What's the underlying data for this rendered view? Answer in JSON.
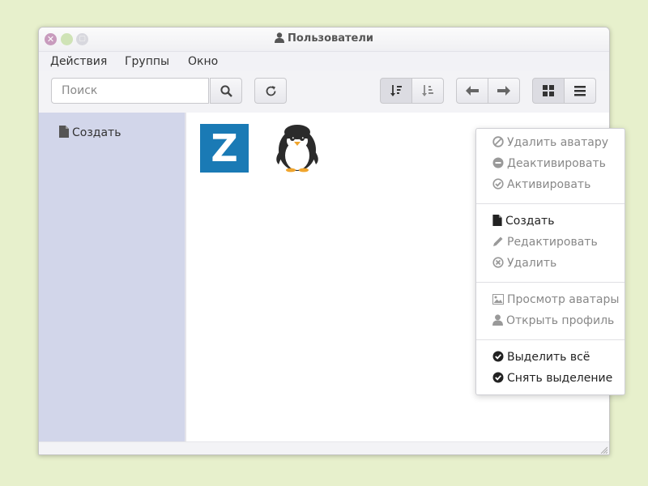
{
  "window": {
    "title": "Пользователи"
  },
  "menubar": {
    "items": [
      "Действия",
      "Группы",
      "Окно"
    ]
  },
  "toolbar": {
    "search_placeholder": "Поиск"
  },
  "sidebar": {
    "items": [
      {
        "label": "Создать"
      }
    ]
  },
  "avatars": [
    {
      "letter": "Z",
      "bg": "#1a7ab5"
    },
    {
      "letter": "",
      "bg": "#ffffff"
    }
  ],
  "context_menu": {
    "groups": [
      [
        {
          "label": "Удалить аватару",
          "icon": "ban-icon",
          "enabled": false
        },
        {
          "label": "Деактивировать",
          "icon": "minus-circle-icon",
          "enabled": false
        },
        {
          "label": "Активировать",
          "icon": "check-circle-outline-icon",
          "enabled": false
        }
      ],
      [
        {
          "label": "Создать",
          "icon": "file-icon",
          "enabled": true
        },
        {
          "label": "Редактировать",
          "icon": "pencil-icon",
          "enabled": false
        },
        {
          "label": "Удалить",
          "icon": "x-circle-icon",
          "enabled": false
        }
      ],
      [
        {
          "label": "Просмотр аватары",
          "icon": "picture-icon",
          "enabled": false
        },
        {
          "label": "Открыть профиль",
          "icon": "user-icon",
          "enabled": false
        }
      ],
      [
        {
          "label": "Выделить всё",
          "icon": "check-circle-icon",
          "enabled": true
        },
        {
          "label": "Снять выделение",
          "icon": "check-circle-icon",
          "enabled": true
        }
      ]
    ]
  },
  "colors": {
    "background": "#e7f0cc",
    "sidebar": "#d2d6ea",
    "accent": "#1a7ab5"
  }
}
